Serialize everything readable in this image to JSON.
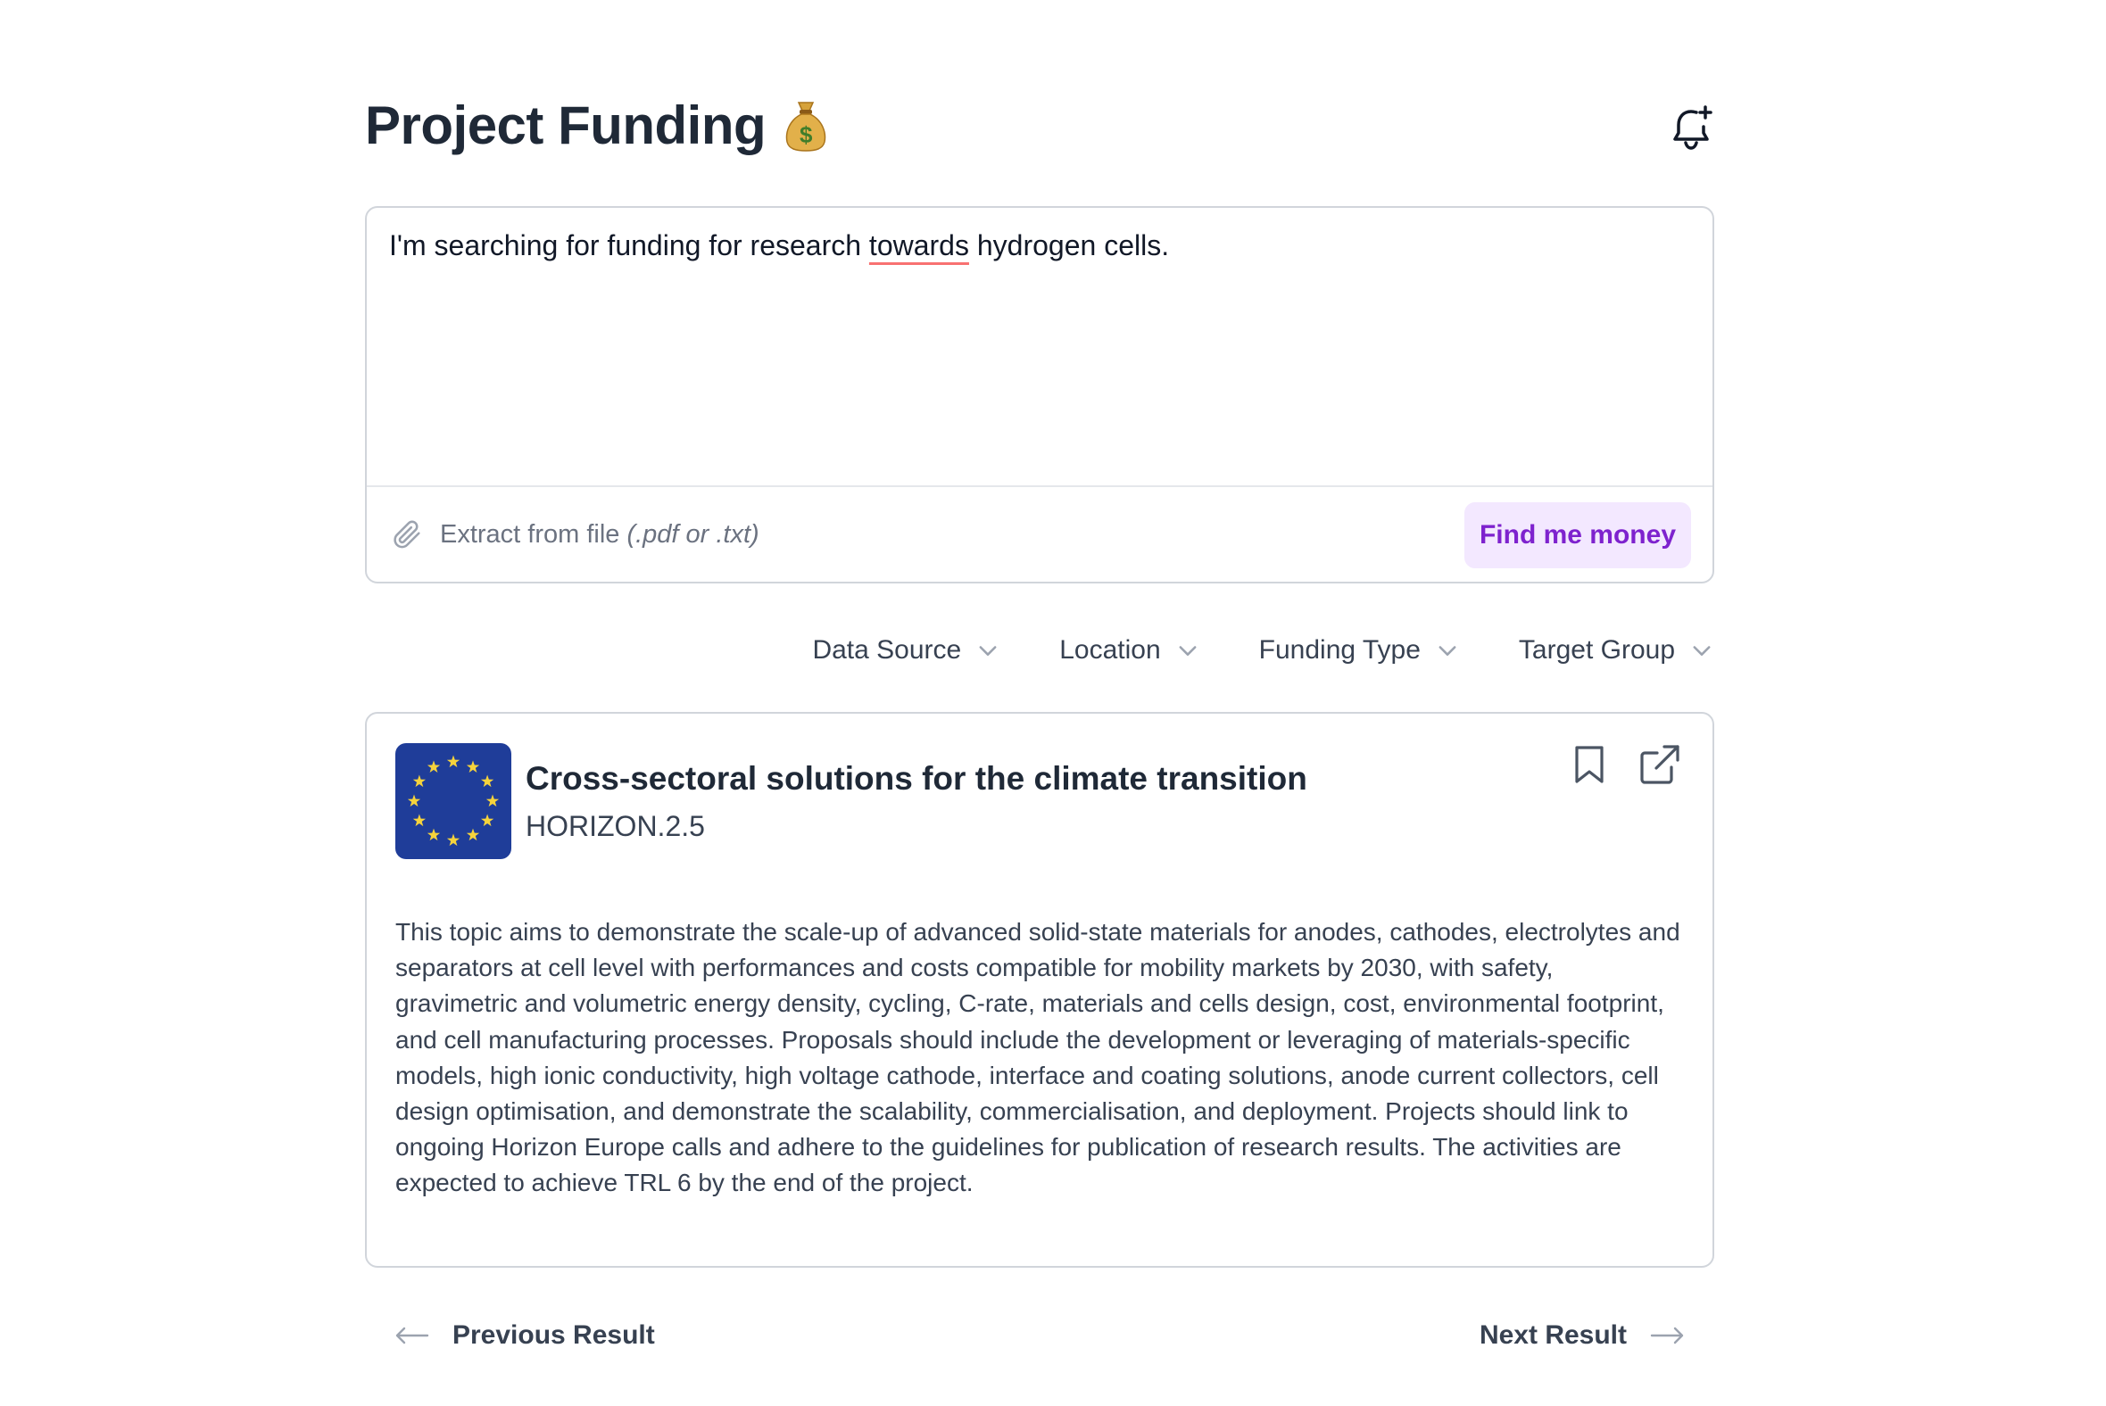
{
  "header": {
    "title": "Project Funding",
    "title_emoji": "money-bag",
    "notification_icon": "bell-plus-icon"
  },
  "search": {
    "query_before": "I'm searching for funding for research ",
    "query_misspelled": "towards",
    "query_after": " hydrogen cells.",
    "attach_label": "Extract from file",
    "attach_hint": "(.pdf or .txt)",
    "submit_label": "Find me money"
  },
  "filters": [
    {
      "label": "Data Source"
    },
    {
      "label": "Location"
    },
    {
      "label": "Funding Type"
    },
    {
      "label": "Target Group"
    }
  ],
  "result": {
    "logo": "eu-flag",
    "title": "Cross-sectoral solutions for the climate transition",
    "code": "HORIZON.2.5",
    "description": "This topic aims to demonstrate the scale-up of advanced solid-state materials for anodes, cathodes, electrolytes and separators at cell level with performances and costs compatible for mobility markets by 2030, with safety, gravimetric and volumetric energy density, cycling, C-rate, materials and cells design, cost, environmental footprint, and cell manufacturing processes. Proposals should include the development or leveraging of materials-specific models, high ionic conductivity, high voltage cathode, interface and coating solutions, anode current collectors, cell design optimisation, and demonstrate the scalability, commercialisation, and deployment. Projects should link to ongoing Horizon Europe calls and adhere to the guidelines for publication of research results. The activities are expected to achieve TRL 6 by the end of the project."
  },
  "pager": {
    "prev_label": "Previous Result",
    "next_label": "Next Result"
  },
  "colors": {
    "accent": "#7e22ce",
    "accent_bg": "#f3e8ff",
    "eu_blue": "#1f3d99",
    "eu_star": "#f6d33c",
    "spell_underline": "#f87171"
  }
}
